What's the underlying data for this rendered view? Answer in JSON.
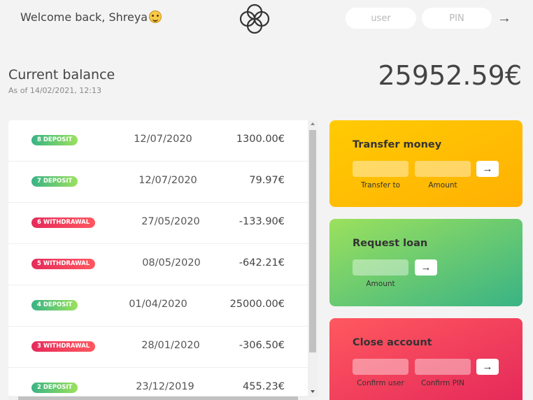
{
  "nav": {
    "welcome": "Welcome back, Shreya",
    "emoji": "grinning-face-emoji",
    "user_placeholder": "user",
    "pin_placeholder": "PIN",
    "login_arrow": "→"
  },
  "balance": {
    "label": "Current balance",
    "date_text": "As of 14/02/2021, 12:13",
    "value": "25952.59€"
  },
  "movements": [
    {
      "badge": "8 deposit",
      "type": "deposit",
      "date": "12/07/2020",
      "amount": "1300.00€"
    },
    {
      "badge": "7 deposit",
      "type": "deposit",
      "date": "12/07/2020",
      "amount": "79.97€"
    },
    {
      "badge": "6 withdrawal",
      "type": "withdrawal",
      "date": "27/05/2020",
      "amount": "-133.90€"
    },
    {
      "badge": "5 withdrawal",
      "type": "withdrawal",
      "date": "08/05/2020",
      "amount": "-642.21€"
    },
    {
      "badge": "4 deposit",
      "type": "deposit",
      "date": "01/04/2020",
      "amount": "25000.00€"
    },
    {
      "badge": "3 withdrawal",
      "type": "withdrawal",
      "date": "28/01/2020",
      "amount": "-306.50€"
    },
    {
      "badge": "2 deposit",
      "type": "deposit",
      "date": "23/12/2019",
      "amount": "455.23€"
    }
  ],
  "operations": {
    "transfer": {
      "title": "Transfer money",
      "label_to": "Transfer to",
      "label_amount": "Amount",
      "button": "→"
    },
    "loan": {
      "title": "Request loan",
      "label_amount": "Amount",
      "button": "→"
    },
    "close": {
      "title": "Close account",
      "label_user": "Confirm user",
      "label_pin": "Confirm PIN",
      "button": "→"
    }
  },
  "colors": {
    "deposit_gradient": [
      "#39b385",
      "#9be15d"
    ],
    "withdrawal_gradient": [
      "#e52a5a",
      "#ff585f"
    ],
    "transfer_gradient": [
      "#ffb003",
      "#ffcb03"
    ],
    "background": "#f3f3f3"
  }
}
